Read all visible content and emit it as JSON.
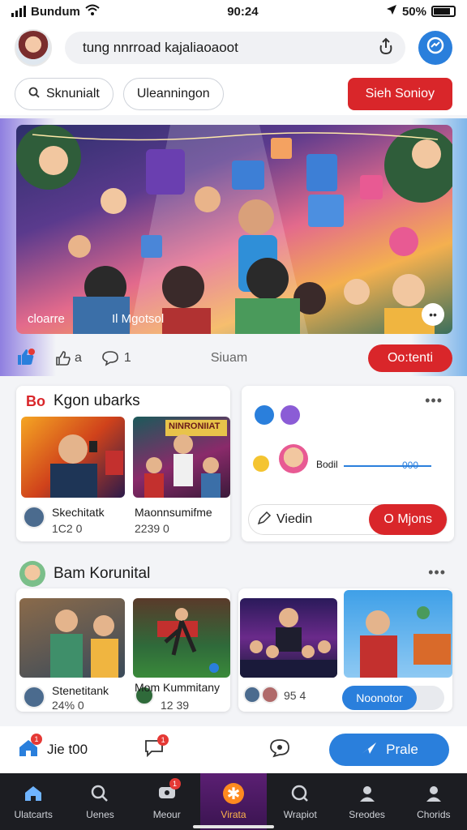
{
  "status": {
    "carrier": "Bundum",
    "time": "90:24",
    "battery": "50%"
  },
  "header": {
    "search_text": "tung nnrroad kajaliaoaoot"
  },
  "chips": {
    "chip1": "Sknunialt",
    "chip2": "Uleanningon",
    "action": "Sieh Sonioy"
  },
  "hero": {
    "caption_left": "cloarre",
    "caption_mid": "Il Mgotsol",
    "more": "••"
  },
  "post_actions": {
    "like_count": "a",
    "comment_count": "1",
    "share_label": "Siuam",
    "follow_label": "Oo:tenti"
  },
  "section1": {
    "badge": "Bo",
    "title": "Kgon ubarks",
    "items": [
      {
        "title": "Skechitatk",
        "meta": "1C2 0"
      },
      {
        "title": "Maonnsumifme",
        "meta": "2239 0"
      }
    ],
    "thumb2_text": "NINRONIIAT"
  },
  "section2": {
    "audio_label": "Bodil",
    "audio_time": "000",
    "video_label": "Viedin",
    "join_label": "O Mjons"
  },
  "section3": {
    "title": "Bam Korunital",
    "items": [
      {
        "title": "Stenetitank",
        "meta": "24% 0"
      },
      {
        "title": "Mom Kummitany",
        "meta": "12 39"
      },
      {
        "title": "",
        "meta": "95 4"
      }
    ],
    "pill_label": "Noonotor"
  },
  "actionbar": {
    "tab_label": "Jie t00",
    "post_label": "Prale"
  },
  "tabs": [
    {
      "label": "Ulatcarts",
      "icon": "home-icon"
    },
    {
      "label": "Uenes",
      "icon": "search-icon"
    },
    {
      "label": "Meour",
      "icon": "message-icon"
    },
    {
      "label": "Virata",
      "icon": "star-burst-icon"
    },
    {
      "label": "Wrapiot",
      "icon": "search-icon"
    },
    {
      "label": "Sreodes",
      "icon": "person-icon"
    },
    {
      "label": "Chorids",
      "icon": "person-icon"
    }
  ],
  "colors": {
    "brand_blue": "#2a7fdc",
    "brand_red": "#d9262a",
    "tabbar": "#1c1d22",
    "active_orange": "#ff8a1f"
  }
}
